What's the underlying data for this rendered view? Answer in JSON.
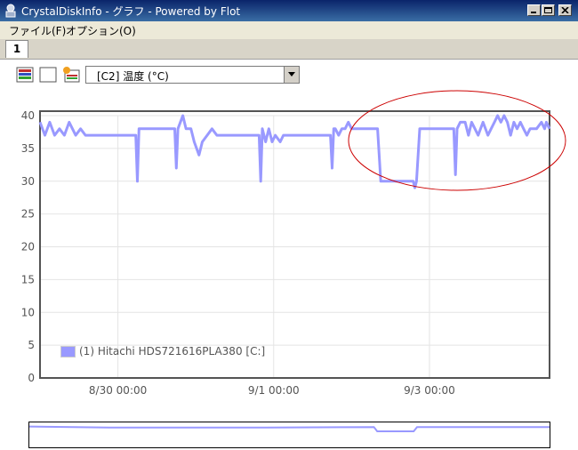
{
  "window": {
    "title": "CrystalDiskInfo - グラフ - Powered by Flot",
    "controls": [
      "minimize",
      "maximize",
      "close"
    ]
  },
  "menu": {
    "items": [
      {
        "label": "ファイル(F)"
      },
      {
        "label": "オプション(O)"
      }
    ]
  },
  "tabs": [
    {
      "label": "1"
    }
  ],
  "toolbar": {
    "icons": [
      "all-select-icon",
      "none-select-icon",
      "attribute-icon"
    ],
    "select_value": "[C2] 温度 (°C)"
  },
  "colors": {
    "series": "#9999ff",
    "annotation": "#cc0000",
    "titlebar": "#0a246a"
  },
  "chart_data": {
    "type": "line",
    "title": "",
    "xlabel": "",
    "ylabel": "",
    "ylim": [
      0,
      40
    ],
    "yticks": [
      "0",
      "5",
      "10",
      "15",
      "20",
      "25",
      "30",
      "35",
      "40"
    ],
    "xticks": [
      {
        "label": "8/30 00:00",
        "x": "8/30 00:00"
      },
      {
        "label": "9/1 00:00",
        "x": "9/1 00:00"
      },
      {
        "label": "9/3 00:00",
        "x": "9/3 00:00"
      }
    ],
    "grid": true,
    "legend": "bottom-left",
    "annotation": "red ellipse highlighting latest readings",
    "series": [
      {
        "name": "(1) Hitachi HDS721616PLA380 [C:]",
        "points": [
          {
            "x": "8/29 00:00",
            "y": 39
          },
          {
            "x": "8/29 01:30",
            "y": 37
          },
          {
            "x": "8/29 03:00",
            "y": 39
          },
          {
            "x": "8/29 04:30",
            "y": 37
          },
          {
            "x": "8/29 06:00",
            "y": 38
          },
          {
            "x": "8/29 07:30",
            "y": 37
          },
          {
            "x": "8/29 09:00",
            "y": 39
          },
          {
            "x": "8/29 11:00",
            "y": 37
          },
          {
            "x": "8/29 12:30",
            "y": 38
          },
          {
            "x": "8/29 14:00",
            "y": 37
          },
          {
            "x": "8/29 18:00",
            "y": 37
          },
          {
            "x": "8/29 20:00",
            "y": 37
          },
          {
            "x": "8/29 22:00",
            "y": 37
          },
          {
            "x": "8/30 00:00",
            "y": 37
          },
          {
            "x": "8/30 02:00",
            "y": 37
          },
          {
            "x": "8/30 04:00",
            "y": 37
          },
          {
            "x": "8/30 05:30",
            "y": 37
          },
          {
            "x": "8/30 06:00",
            "y": 30
          },
          {
            "x": "8/30 06:30",
            "y": 38
          },
          {
            "x": "8/30 10:00",
            "y": 38
          },
          {
            "x": "8/30 14:00",
            "y": 38
          },
          {
            "x": "8/30 16:00",
            "y": 38
          },
          {
            "x": "8/30 17:30",
            "y": 38
          },
          {
            "x": "8/30 18:00",
            "y": 32
          },
          {
            "x": "8/30 18:30",
            "y": 38
          },
          {
            "x": "8/30 20:00",
            "y": 40
          },
          {
            "x": "8/30 21:00",
            "y": 38
          },
          {
            "x": "8/30 22:30",
            "y": 38
          },
          {
            "x": "8/30 23:30",
            "y": 36
          },
          {
            "x": "8/31 01:00",
            "y": 34
          },
          {
            "x": "8/31 02:00",
            "y": 36
          },
          {
            "x": "8/31 03:30",
            "y": 37
          },
          {
            "x": "8/31 05:00",
            "y": 38
          },
          {
            "x": "8/31 06:30",
            "y": 37
          },
          {
            "x": "8/31 10:00",
            "y": 37
          },
          {
            "x": "8/31 14:00",
            "y": 37
          },
          {
            "x": "8/31 18:00",
            "y": 37
          },
          {
            "x": "8/31 19:30",
            "y": 37
          },
          {
            "x": "8/31 20:00",
            "y": 30
          },
          {
            "x": "8/31 20:30",
            "y": 38
          },
          {
            "x": "8/31 21:30",
            "y": 36
          },
          {
            "x": "8/31 22:30",
            "y": 38
          },
          {
            "x": "8/31 23:30",
            "y": 36
          },
          {
            "x": "9/1 00:30",
            "y": 37
          },
          {
            "x": "9/1 02:00",
            "y": 36
          },
          {
            "x": "9/1 03:00",
            "y": 37
          },
          {
            "x": "9/1 06:00",
            "y": 37
          },
          {
            "x": "9/1 10:00",
            "y": 37
          },
          {
            "x": "9/1 14:00",
            "y": 37
          },
          {
            "x": "9/1 16:00",
            "y": 37
          },
          {
            "x": "9/1 17:30",
            "y": 37
          },
          {
            "x": "9/1 18:00",
            "y": 32
          },
          {
            "x": "9/1 18:30",
            "y": 38
          },
          {
            "x": "9/1 19:00",
            "y": 38
          },
          {
            "x": "9/1 20:00",
            "y": 37
          },
          {
            "x": "9/1 21:00",
            "y": 38
          },
          {
            "x": "9/1 22:00",
            "y": 38
          },
          {
            "x": "9/1 23:00",
            "y": 39
          },
          {
            "x": "9/2 00:00",
            "y": 38
          },
          {
            "x": "9/2 02:00",
            "y": 38
          },
          {
            "x": "9/2 06:00",
            "y": 38
          },
          {
            "x": "9/2 08:00",
            "y": 38
          },
          {
            "x": "9/2 09:00",
            "y": 30
          },
          {
            "x": "9/2 12:00",
            "y": 30
          },
          {
            "x": "9/2 16:00",
            "y": 30
          },
          {
            "x": "9/2 19:00",
            "y": 30
          },
          {
            "x": "9/2 19:30",
            "y": 29
          },
          {
            "x": "9/2 20:00",
            "y": 30
          },
          {
            "x": "9/2 21:00",
            "y": 38
          },
          {
            "x": "9/3 00:00",
            "y": 38
          },
          {
            "x": "9/3 03:00",
            "y": 38
          },
          {
            "x": "9/3 05:00",
            "y": 38
          },
          {
            "x": "9/3 06:00",
            "y": 38
          },
          {
            "x": "9/3 07:30",
            "y": 38
          },
          {
            "x": "9/3 08:00",
            "y": 31
          },
          {
            "x": "9/3 08:30",
            "y": 38
          },
          {
            "x": "9/3 09:30",
            "y": 39
          },
          {
            "x": "9/3 11:00",
            "y": 39
          },
          {
            "x": "9/3 12:00",
            "y": 37
          },
          {
            "x": "9/3 13:00",
            "y": 39
          },
          {
            "x": "9/3 14:00",
            "y": 38
          },
          {
            "x": "9/3 15:00",
            "y": 37
          },
          {
            "x": "9/3 16:30",
            "y": 39
          },
          {
            "x": "9/3 18:00",
            "y": 37
          },
          {
            "x": "9/3 19:00",
            "y": 38
          },
          {
            "x": "9/3 20:00",
            "y": 39
          },
          {
            "x": "9/3 21:00",
            "y": 40
          },
          {
            "x": "9/3 22:00",
            "y": 39
          },
          {
            "x": "9/3 23:00",
            "y": 40
          },
          {
            "x": "9/4 00:00",
            "y": 39
          },
          {
            "x": "9/4 01:00",
            "y": 37
          },
          {
            "x": "9/4 02:00",
            "y": 39
          },
          {
            "x": "9/4 03:00",
            "y": 38
          },
          {
            "x": "9/4 04:00",
            "y": 39
          },
          {
            "x": "9/4 05:00",
            "y": 38
          },
          {
            "x": "9/4 06:00",
            "y": 37
          },
          {
            "x": "9/4 07:00",
            "y": 38
          },
          {
            "x": "9/4 09:00",
            "y": 38
          },
          {
            "x": "9/4 10:30",
            "y": 39
          },
          {
            "x": "9/4 11:30",
            "y": 38
          },
          {
            "x": "9/4 12:00",
            "y": 39
          },
          {
            "x": "9/4 13:00",
            "y": 38
          }
        ]
      }
    ],
    "overview_points": [
      {
        "x": "8/29 00:00",
        "y": 39
      },
      {
        "x": "8/30 00:00",
        "y": 37
      },
      {
        "x": "8/31 00:00",
        "y": 37
      },
      {
        "x": "9/1 00:00",
        "y": 37
      },
      {
        "x": "9/2 08:00",
        "y": 38
      },
      {
        "x": "9/2 09:00",
        "y": 30
      },
      {
        "x": "9/2 20:00",
        "y": 30
      },
      {
        "x": "9/2 21:00",
        "y": 38
      },
      {
        "x": "9/4 13:00",
        "y": 38
      }
    ]
  }
}
